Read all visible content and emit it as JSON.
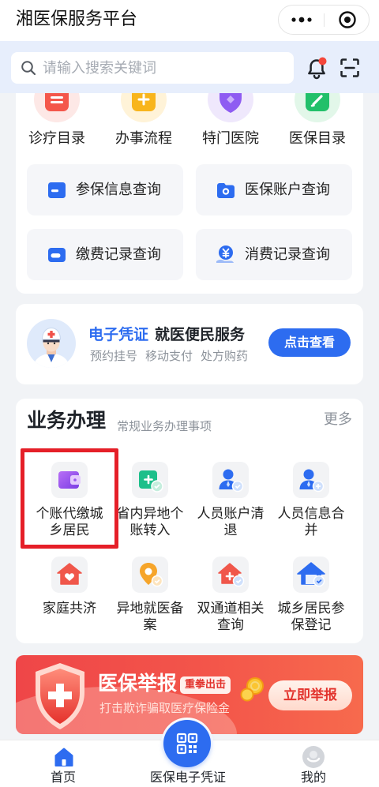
{
  "header": {
    "title": "湘医保服务平台",
    "capsule": {
      "more_icon": "more-dots-icon",
      "close_icon": "target-icon"
    }
  },
  "search": {
    "placeholder": "请输入搜索关键词",
    "value": "",
    "icon": "search-icon",
    "notification_icon": "bell-icon",
    "has_unread": true,
    "scan_icon": "scan-icon"
  },
  "quick_entries": [
    {
      "label": "诊疗目录",
      "icon": "catalog-icon",
      "color": "#f4574b"
    },
    {
      "label": "办事流程",
      "icon": "process-icon",
      "color": "#f8b51c"
    },
    {
      "label": "特门医院",
      "icon": "hospital-icon",
      "color": "#8e5cf2"
    },
    {
      "label": "医保目录",
      "icon": "insurance-catalog-icon",
      "color": "#22c06a"
    }
  ],
  "query_buttons": [
    {
      "label": "参保信息查询",
      "icon": "insurance-card-icon"
    },
    {
      "label": "医保账户查询",
      "icon": "wallet-icon"
    },
    {
      "label": "缴费记录查询",
      "icon": "payment-card-icon"
    },
    {
      "label": "消费记录查询",
      "icon": "yuan-coin-icon"
    }
  ],
  "promo": {
    "highlight": "电子凭证",
    "title": "就医便民服务",
    "features": [
      "预约挂号",
      "移动支付",
      "处方购药"
    ],
    "button": "点击查看",
    "avatar_icon": "doctor-avatar-icon"
  },
  "business": {
    "title": "业务办理",
    "subtitle": "常规业务办理事项",
    "more": "更多",
    "items": [
      {
        "label": "个账代缴城乡居民",
        "icon": "purple-card-icon",
        "highlighted": true
      },
      {
        "label": "省内异地个账转入",
        "icon": "transfer-in-icon"
      },
      {
        "label": "人员账户清退",
        "icon": "person-refund-icon"
      },
      {
        "label": "人员信息合并",
        "icon": "person-merge-icon"
      },
      {
        "label": "家庭共济",
        "icon": "family-house-icon"
      },
      {
        "label": "异地就医备案",
        "icon": "location-pin-icon"
      },
      {
        "label": "双通道相关查询",
        "icon": "pharmacy-house-icon"
      },
      {
        "label": "城乡居民参保登记",
        "icon": "residence-roof-icon"
      }
    ]
  },
  "report_banner": {
    "title": "医保举报",
    "badge": "重拳出击",
    "subtitle": "打击欺诈骗取医疗保险金",
    "button": "立即举报",
    "icon": "shield-cross-icon"
  },
  "tabbar": {
    "items": [
      {
        "label": "首页",
        "icon": "home-icon",
        "active": true
      },
      {
        "label": "医保电子凭证",
        "icon": "qr-code-icon",
        "active": false
      },
      {
        "label": "我的",
        "icon": "profile-avatar-icon",
        "active": false
      }
    ]
  },
  "colors": {
    "primary": "#2d6cf0",
    "highlight_border": "#e51f28",
    "banner_red": "#ef4648",
    "unread_dot": "#f5473b"
  }
}
